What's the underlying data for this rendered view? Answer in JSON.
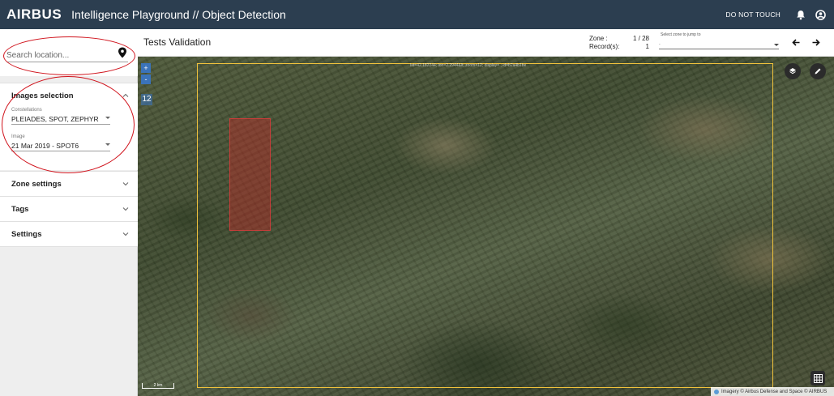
{
  "appbar": {
    "logo": "AIRBUS",
    "title": "Intelligence Playground // Object Detection",
    "do_not_touch": "DO NOT TOUCH",
    "bell_icon": "bell-icon",
    "account_icon": "account-circle-icon",
    "color": "#2c3e50"
  },
  "sidebar": {
    "search_placeholder": "Search location...",
    "search_icon": "map-pin-icon",
    "panels": {
      "images": {
        "title": "Images selection",
        "constellations_label": "Constellations",
        "constellations_value": "PLEIADES, SPOT, ZEPHYR",
        "image_label": "Image",
        "image_value": "21 Mar 2019 - SPOT6"
      },
      "zone_settings": {
        "title": "Zone settings"
      },
      "tags": {
        "title": "Tags"
      },
      "settings": {
        "title": "Settings"
      }
    }
  },
  "main": {
    "title": "Tests Validation",
    "zone_label": "Zone :",
    "zone_value": "1 / 28",
    "records_label": "Record(s):",
    "records_value": "1",
    "jump_label": "Select zone to jump to",
    "jump_value": "-"
  },
  "map": {
    "zoom_in": "+",
    "zoom_out": "-",
    "zoom_level": "12",
    "url_overlay": "lat=42.182244; lon=2.2944&lt; zoom=12; display= ; id=b2a4b1be",
    "scale": "2 km",
    "attribution": "Imagery © Airbus Defense and Space © AIRBUS",
    "accent_zone": "#f0c23c",
    "accent_detection": "#c82828"
  }
}
